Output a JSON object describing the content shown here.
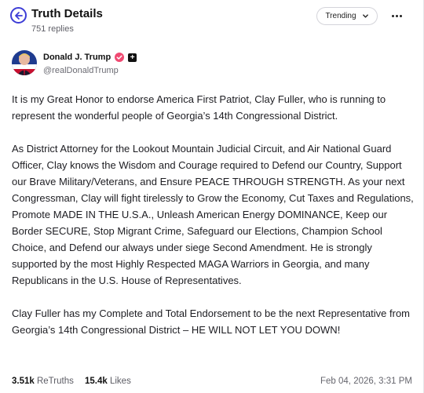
{
  "header": {
    "title": "Truth Details",
    "replies": "751 replies",
    "trending_label": "Trending"
  },
  "author": {
    "name": "Donald J. Trump",
    "handle": "@realDonaldTrump"
  },
  "post": {
    "paragraphs": [
      "It is my Great Honor to endorse America First Patriot, Clay Fuller, who is running to represent the wonderful people of Georgia’s 14th Congressional District.",
      "As District Attorney for the Lookout Mountain Judicial Circuit, and Air National Guard Officer, Clay knows the Wisdom and Courage required to Defend our Country, Support our Brave Military/Veterans, and Ensure PEACE THROUGH STRENGTH. As your next Congressman, Clay will fight tirelessly to Grow the Economy, Cut Taxes and Regulations, Promote MADE IN THE U.S.A., Unleash American Energy DOMINANCE, Keep our Border SECURE, Stop Migrant Crime, Safeguard our Elections, Champion School Choice, and Defend our always under siege Second Amendment. He is strongly supported by the most Highly Respected MAGA Warriors in Georgia, and many Republicans in the U.S. House of Representatives.",
      "Clay Fuller has my Complete and Total Endorsement to be the next Representative from Georgia’s 14th Congressional District – HE WILL NOT LET YOU DOWN!"
    ]
  },
  "stats": {
    "retruths_count": "3.51k",
    "retruths_label": "ReTruths",
    "likes_count": "15.4k",
    "likes_label": "Likes",
    "timestamp": "Feb 04, 2026, 3:31 PM"
  },
  "colors": {
    "accent": "#3d3dd6",
    "verified_badge": "#f04a72"
  },
  "icons": {
    "back": "arrow-left-circle-icon",
    "trending_dropdown": "chevron-down-icon",
    "more": "more-horizontal-icon",
    "verified": "verified-badge-icon",
    "plus_badge": "plus-badge-icon"
  }
}
